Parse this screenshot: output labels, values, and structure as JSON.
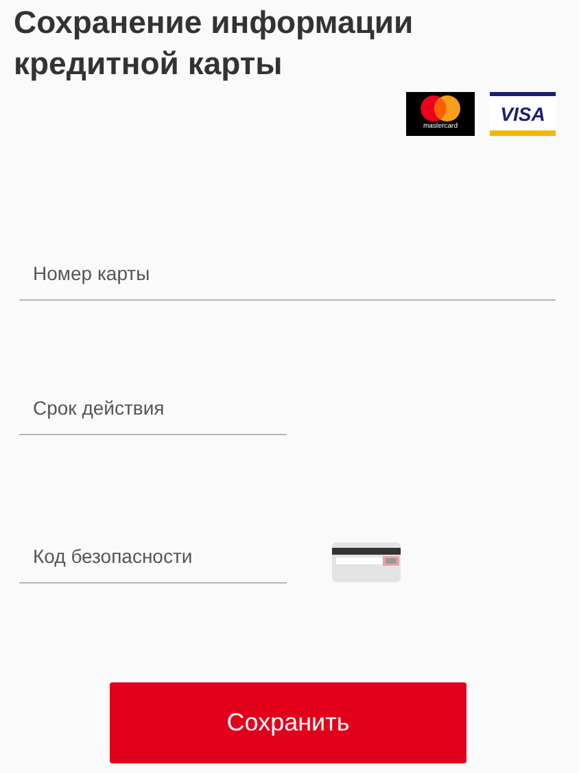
{
  "title": "Сохранение информации кредитной карты",
  "card_logos": [
    {
      "kind": "mastercard",
      "label": "mastercard"
    },
    {
      "kind": "visa",
      "label": "VISA"
    }
  ],
  "fields": [
    {
      "kind": "wide",
      "placeholder": "Номер карты"
    },
    {
      "kind": "narrow",
      "placeholder": "Срок действия"
    },
    {
      "kind": "cvv",
      "placeholder": "Код безопасности"
    }
  ],
  "save_button": "Сохранить"
}
